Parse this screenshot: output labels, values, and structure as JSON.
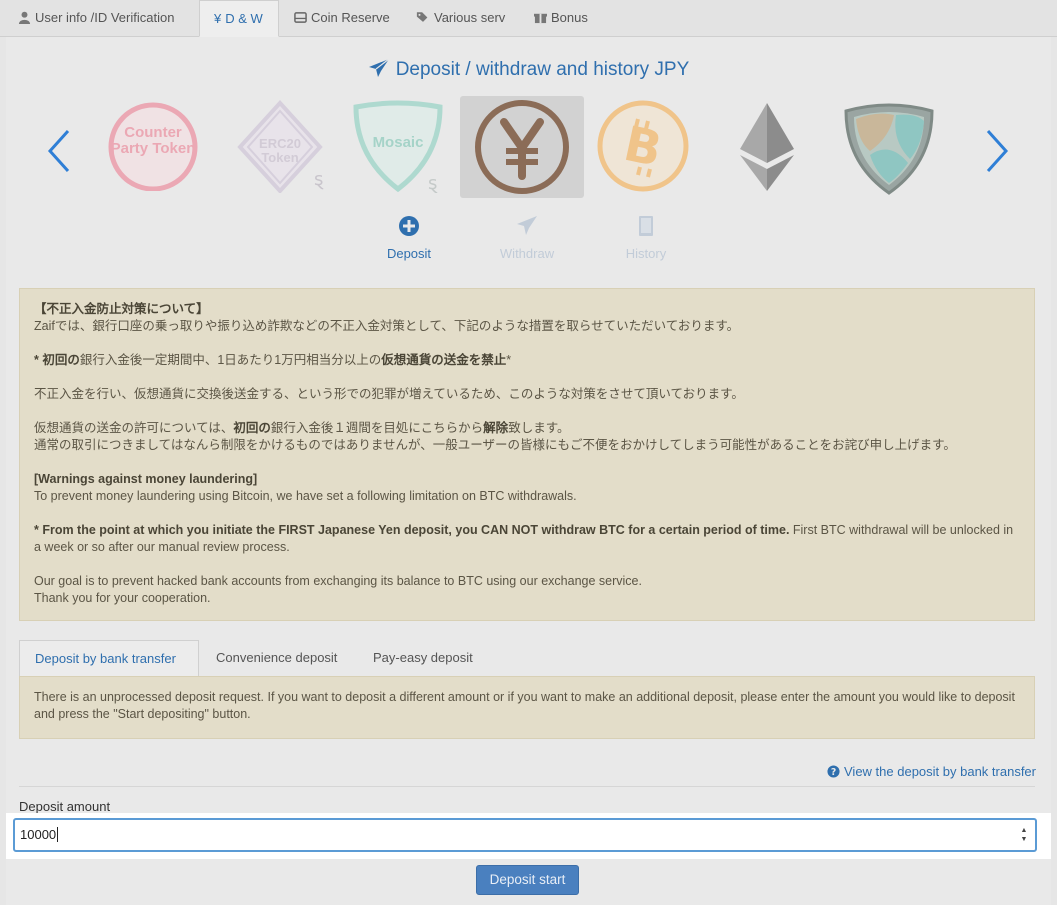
{
  "tabs": [
    {
      "label": "User info /ID Verification",
      "icon": "user-icon"
    },
    {
      "label": "D & W",
      "icon": "yen-icon",
      "active": true
    },
    {
      "label": "Coin Reserve",
      "icon": "drive-icon"
    },
    {
      "label": "Various serv",
      "icon": "tags-icon"
    },
    {
      "label": "Bonus",
      "icon": "gift-icon"
    }
  ],
  "page": {
    "title": "Deposit / withdraw and history JPY"
  },
  "coins": {
    "counterparty": "Counter Party Token",
    "erc20": "ERC20 Token",
    "mosaic": "Mosaic",
    "selected": "JPY"
  },
  "actions": {
    "deposit": "Deposit",
    "withdraw": "Withdraw",
    "history": "History"
  },
  "warning": {
    "jp_title": "【不正入金防止対策について】",
    "jp_line1": "Zaifでは、銀行口座の乗っ取りや振り込め詐欺などの不正入金対策として、下記のような措置を取らせていただいております。",
    "jp_bold_prefix": "* ",
    "jp_bold_a": "初回の",
    "jp_mid_a": "銀行入金後一定期間中、1日あたり1万円相当分以上の",
    "jp_bold_b": "仮想通貨の送金を禁止",
    "jp_suffix": "*",
    "jp_line3": "不正入金を行い、仮想通貨に交換後送金する、という形での犯罪が増えているため、このような対策をさせて頂いております。",
    "jp_line4a": "仮想通貨の送金の許可については、",
    "jp_line4b": "初回の",
    "jp_line4c": "銀行入金後１週間を目処にこちらから",
    "jp_line4d": "解除",
    "jp_line4e": "致します。",
    "jp_line5": "通常の取引につきましてはなんら制限をかけるものではありませんが、一般ユーザーの皆様にもご不便をおかけしてしまう可能性があることをお詫び申し上げます。",
    "en_title": "[Warnings against money laundering]",
    "en_line1": "To prevent money laundering using Bitcoin, we have set a following limitation on BTC withdrawals.",
    "en_bold": "* From the point at which you initiate the FIRST Japanese Yen deposit, you CAN NOT withdraw BTC for a certain period of time.",
    "en_rest": " First BTC withdrawal will be unlocked in a week or so after our manual review process.",
    "en_goal": "Our goal is to prevent hacked bank accounts from exchanging its balance to BTC using our exchange service.",
    "en_thanks": "Thank you for your cooperation."
  },
  "subtabs": [
    {
      "label": "Deposit by bank transfer",
      "active": true
    },
    {
      "label": "Convenience deposit"
    },
    {
      "label": "Pay-easy deposit"
    }
  ],
  "notice": "There is an unprocessed deposit request. If you want to deposit a different amount or if you want to make an additional deposit, please enter the amount you would like to deposit and press the \"Start depositing\" button.",
  "view_link": "View the deposit by bank transfer",
  "deposit": {
    "label": "Deposit amount",
    "value": "10000",
    "button": "Deposit start"
  },
  "colors": {
    "accent": "#2f6fae",
    "warning_bg": "#e3ddc9",
    "button": "#4a80bf"
  }
}
